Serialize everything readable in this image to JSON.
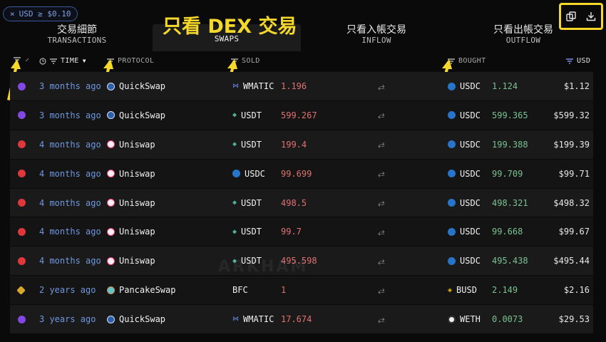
{
  "filter_chip": {
    "close": "×",
    "label": "USD ≥ $0.10"
  },
  "tabs": [
    {
      "zh": "交易細節",
      "en": "TRANSACTIONS"
    },
    {
      "zh": "",
      "en": "SWAPS",
      "annotation": "只看 DEX 交易"
    },
    {
      "zh": "只看入帳交易",
      "en": "INFLOW"
    },
    {
      "zh": "只看出帳交易",
      "en": "OUTFLOW"
    }
  ],
  "columns": {
    "time": "TIME",
    "protocol": "PROTOCOL",
    "sold": "SOLD",
    "bought": "BOUGHT",
    "usd": "USD"
  },
  "icons": {
    "copy": "copy-icon",
    "download": "download-icon",
    "filter": "filter-lines-icon",
    "clock": "clock-icon",
    "swap": "swap-arrows-icon"
  },
  "colors": {
    "accent_yellow": "#f6d82b",
    "time_link": "#6f97e0",
    "sold_red": "#e07272",
    "bought_green": "#78c292",
    "polygon": "#8247e5",
    "optimism": "#e0363c",
    "bnb": "#d8a928"
  },
  "watermark": "ARKHAM",
  "swaps": [
    {
      "chain": "polygon",
      "time": "3 months ago",
      "protocol": "QuickSwap",
      "sold_token": "WMATIC",
      "sold_amount": "1.196",
      "bought_token": "USDC",
      "bought_amount": "1.124",
      "usd": "$1.12"
    },
    {
      "chain": "polygon",
      "time": "3 months ago",
      "protocol": "QuickSwap",
      "sold_token": "USDT",
      "sold_amount": "599.267",
      "bought_token": "USDC",
      "bought_amount": "599.365",
      "usd": "$599.32"
    },
    {
      "chain": "optimism",
      "time": "4 months ago",
      "protocol": "Uniswap",
      "sold_token": "USDT",
      "sold_amount": "199.4",
      "bought_token": "USDC",
      "bought_amount": "199.388",
      "usd": "$199.39"
    },
    {
      "chain": "optimism",
      "time": "4 months ago",
      "protocol": "Uniswap",
      "sold_token": "USDC",
      "sold_amount": "99.699",
      "bought_token": "USDC",
      "bought_amount": "99.709",
      "usd": "$99.71"
    },
    {
      "chain": "optimism",
      "time": "4 months ago",
      "protocol": "Uniswap",
      "sold_token": "USDT",
      "sold_amount": "498.5",
      "bought_token": "USDC",
      "bought_amount": "498.321",
      "usd": "$498.32"
    },
    {
      "chain": "optimism",
      "time": "4 months ago",
      "protocol": "Uniswap",
      "sold_token": "USDT",
      "sold_amount": "99.7",
      "bought_token": "USDC",
      "bought_amount": "99.668",
      "usd": "$99.67"
    },
    {
      "chain": "optimism",
      "time": "4 months ago",
      "protocol": "Uniswap",
      "sold_token": "USDT",
      "sold_amount": "495.598",
      "bought_token": "USDC",
      "bought_amount": "495.438",
      "usd": "$495.44"
    },
    {
      "chain": "bnb",
      "time": "2 years ago",
      "protocol": "PancakeSwap",
      "sold_token": "BFC",
      "sold_amount": "1",
      "bought_token": "BUSD",
      "bought_amount": "2.149",
      "usd": "$2.16"
    },
    {
      "chain": "polygon",
      "time": "3 years ago",
      "protocol": "QuickSwap",
      "sold_token": "WMATIC",
      "sold_amount": "17.674",
      "bought_token": "WETH",
      "bought_amount": "0.0073",
      "usd": "$29.53"
    }
  ]
}
